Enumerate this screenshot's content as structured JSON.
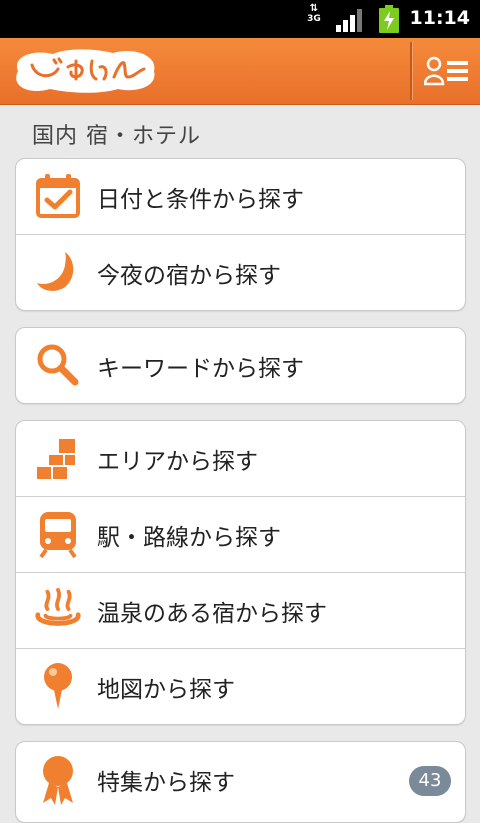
{
  "status_bar": {
    "network": "3G",
    "time": "11:14"
  },
  "header": {
    "logo_text": "じゃらん"
  },
  "section": {
    "title": "国内 宿・ホテル"
  },
  "groups": [
    {
      "items": [
        {
          "label": "日付と条件から探す",
          "icon": "calendar-icon"
        },
        {
          "label": "今夜の宿から探す",
          "icon": "moon-icon"
        }
      ]
    },
    {
      "items": [
        {
          "label": "キーワードから探す",
          "icon": "search-icon"
        }
      ]
    },
    {
      "items": [
        {
          "label": "エリアから探す",
          "icon": "area-blocks-icon"
        },
        {
          "label": "駅・路線から探す",
          "icon": "train-icon"
        },
        {
          "label": "温泉のある宿から探す",
          "icon": "hot-spring-icon"
        },
        {
          "label": "地図から探す",
          "icon": "map-pin-icon"
        }
      ]
    },
    {
      "items": [
        {
          "label": "特集から探す",
          "icon": "rosette-icon",
          "badge": "43"
        }
      ]
    }
  ],
  "colors": {
    "accent": "#f0802f",
    "header": "#ee7a30",
    "badge": "#7b8a98"
  }
}
